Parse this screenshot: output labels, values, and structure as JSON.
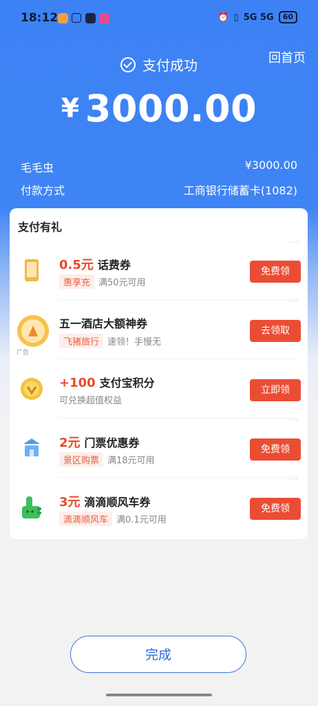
{
  "status_bar": {
    "time": "18:12",
    "right": "5G 5G",
    "battery": "60"
  },
  "header": {
    "home_label": "回首页",
    "title": "支付成功",
    "currency": "¥",
    "amount": "3000.00"
  },
  "payee": {
    "label": "毛毛虫",
    "value": "¥3000.00"
  },
  "payment_method": {
    "label": "付款方式",
    "value": "工商银行储蓄卡(1082)"
  },
  "gifts": {
    "title": "支付有礼",
    "items": [
      {
        "highlight": "0.5元",
        "title": "话费券",
        "tag": "惠享充",
        "desc": "满50元可用",
        "button": "免费领",
        "icon": "phone-icon"
      },
      {
        "highlight": "",
        "title": "五一酒店大额神券",
        "tag": "飞猪旅行",
        "desc": "速领！手慢无",
        "button": "去领取",
        "icon": "hotel-coupon-icon",
        "ad": "广告"
      },
      {
        "highlight": "+100",
        "title": "支付宝积分",
        "tag": "",
        "desc": "可兑换超值权益",
        "button": "立即领",
        "icon": "points-icon"
      },
      {
        "highlight": "2元",
        "title": "门票优惠券",
        "tag": "景区购票",
        "desc": "满18元可用",
        "button": "免费领",
        "icon": "ticket-icon"
      },
      {
        "highlight": "3元",
        "title": "滴滴顺风车券",
        "tag": "滴滴顺风车",
        "desc": "满0.1元可用",
        "button": "免费领",
        "icon": "thumbs-up-icon"
      }
    ]
  },
  "done_label": "完成",
  "colors": {
    "primary": "#3d82f5",
    "button_red": "#eb4d34",
    "highlight": "#e64a2e"
  }
}
